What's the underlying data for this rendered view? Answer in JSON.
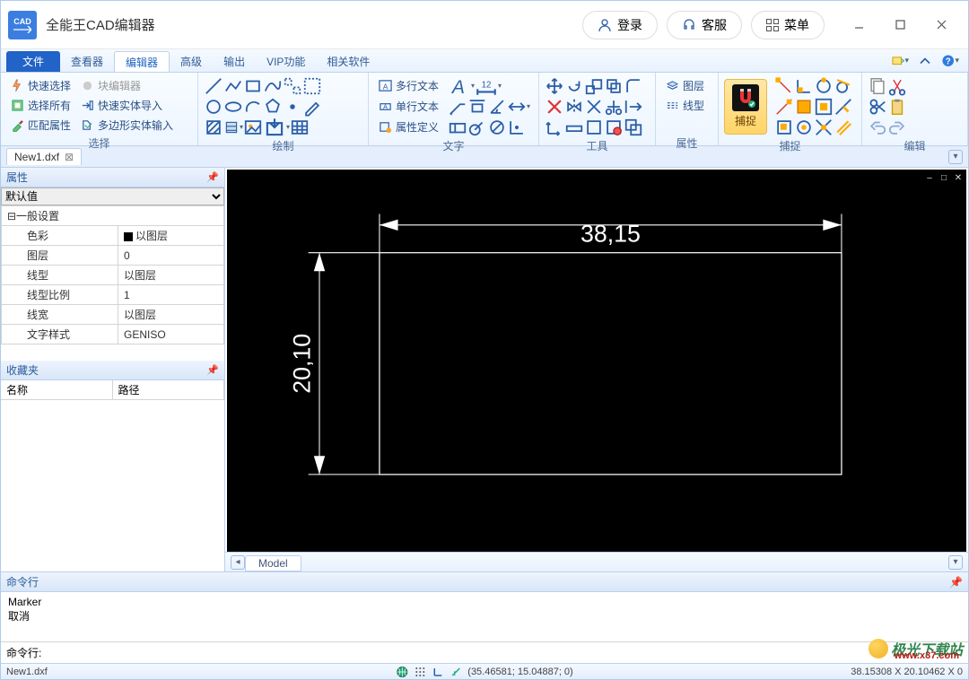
{
  "app": {
    "title": "全能王CAD编辑器",
    "icon_text": "CAD"
  },
  "title_buttons": {
    "login": "登录",
    "support": "客服",
    "menu": "菜单"
  },
  "menu": {
    "file": "文件",
    "tabs": [
      "查看器",
      "编辑器",
      "高级",
      "输出",
      "VIP功能",
      "相关软件"
    ],
    "active_index": 1
  },
  "ribbon": {
    "select": {
      "quick_select": "快速选择",
      "select_all": "选择所有",
      "match_prop": "匹配属性",
      "block_edit": "块编辑器",
      "quick_entity_in": "快速实体导入",
      "polygon_entity_in": "多边形实体输入",
      "label": "选择"
    },
    "draw": {
      "label": "绘制"
    },
    "text": {
      "mtext": "多行文本",
      "stext": "单行文本",
      "attr_def": "属性定义",
      "label": "文字"
    },
    "tools": {
      "label": "工具"
    },
    "props": {
      "layer": "图层",
      "linetype": "线型",
      "label": "属性"
    },
    "snap": {
      "button": "捕捉",
      "label": "捕捉"
    },
    "edit": {
      "label": "编辑"
    }
  },
  "doc_tab": "New1.dxf",
  "props_panel": {
    "title": "属性",
    "dropdown": "默认值",
    "section": "一般设置",
    "rows": [
      {
        "k": "色彩",
        "v": "以图层"
      },
      {
        "k": "图层",
        "v": "0"
      },
      {
        "k": "线型",
        "v": "以图层"
      },
      {
        "k": "线型比例",
        "v": "1"
      },
      {
        "k": "线宽",
        "v": "以图层"
      },
      {
        "k": "文字样式",
        "v": "GENISO"
      }
    ]
  },
  "fav_panel": {
    "title": "收藏夹",
    "cols": [
      "名称",
      "路径"
    ]
  },
  "canvas": {
    "dim_h": "38,15",
    "dim_v": "20,10"
  },
  "model_tab": "Model",
  "cmd": {
    "title": "命令行",
    "lines": [
      "Marker",
      "取消"
    ],
    "prompt": "命令行:"
  },
  "status": {
    "file": "New1.dxf",
    "coords": "(35.46581; 15.04887; 0)",
    "size": "38.15308 X 20.10462 X 0"
  },
  "watermark": "极光下载站"
}
